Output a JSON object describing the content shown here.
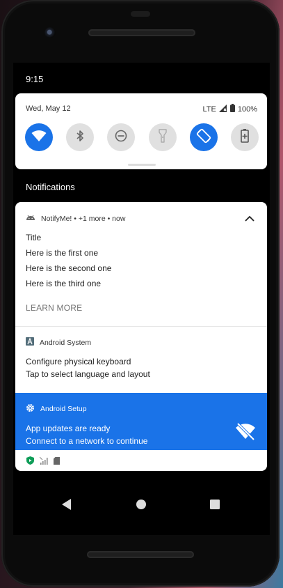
{
  "status_bar": {
    "time": "9:15"
  },
  "quick_settings": {
    "date": "Wed, May 12",
    "network": "LTE",
    "battery": "100%",
    "tiles": [
      {
        "name": "wifi",
        "state": "on"
      },
      {
        "name": "bluetooth",
        "state": "off"
      },
      {
        "name": "do-not-disturb",
        "state": "off"
      },
      {
        "name": "flashlight",
        "state": "off"
      },
      {
        "name": "auto-rotate",
        "state": "on"
      },
      {
        "name": "battery-saver",
        "state": "off"
      }
    ]
  },
  "notifications_header": "Notifications",
  "notifications": [
    {
      "app": "NotifyMe! • +1 more • now",
      "title": "Title",
      "lines": [
        "Here is the first one",
        "Here is the second one",
        "Here is the third one"
      ],
      "action": "LEARN MORE"
    },
    {
      "app": "Android System",
      "title": "Configure physical keyboard",
      "text": "Tap to select language and layout"
    },
    {
      "app": "Android Setup",
      "title": "App updates are ready",
      "text": "Connect to a network to continue",
      "accent": "#1a73e8"
    }
  ],
  "colors": {
    "accent": "#1a73e8",
    "tile_off": "#e0e0e0"
  }
}
